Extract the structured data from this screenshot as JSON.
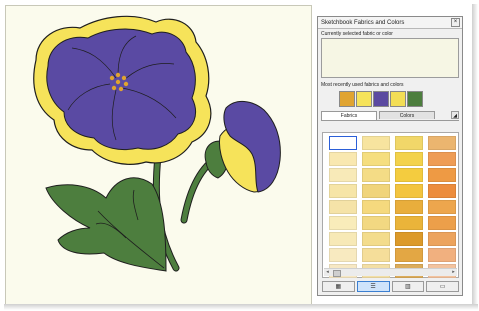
{
  "palette": {
    "title": "Sketchbook Fabrics and Colors",
    "close_label": "×",
    "current_label": "Currently selected fabric or color",
    "recent_label": "Most recently used fabrics and colors",
    "recent_colors": [
      "#e0a431",
      "#f6e35a",
      "#5b4aa0",
      "#f3de55",
      "#4d7e3e"
    ],
    "tabs": [
      {
        "label": "Fabrics",
        "active": true
      },
      {
        "label": "Colors",
        "active": false
      }
    ],
    "tab_arrow": "◢",
    "swatches": [
      "#ffffff",
      "#f7e49f",
      "#f1d769",
      "#ebb56f",
      "#f9e8b0",
      "#f5de7f",
      "#f3d24b",
      "#ee9c55",
      "#f8eab8",
      "#f4dc86",
      "#f4cc3f",
      "#ee9a44",
      "#f6e5a7",
      "#f0d47b",
      "#f3c43f",
      "#ec8c3d",
      "#f5e3a8",
      "#f5d97e",
      "#e9ae3c",
      "#eda64d",
      "#f9ecba",
      "#f2d882",
      "#eab43a",
      "#ec9f4a",
      "#f7e9b7",
      "#f3dc8c",
      "#dc9a2a",
      "#eca35d",
      "#f8eac0",
      "#f5de9a",
      "#e3a744",
      "#f1b07f",
      "#f7e8c4",
      "#f3dfa5",
      "#dcac5b",
      "#f3c39f"
    ],
    "view_buttons": [
      {
        "label": "▦",
        "active": false
      },
      {
        "label": "☰",
        "active": true
      },
      {
        "label": "▥",
        "active": false
      },
      {
        "label": "▭",
        "active": false
      }
    ],
    "scroll_left": "◂",
    "scroll_right": "▸"
  },
  "drawing": {
    "petal_color": "#5a4aa3",
    "rim_color": "#f6e35a",
    "leaf_color": "#4d7e3e",
    "center_color": "#e0a431",
    "outline_color": "#1e1e1e"
  }
}
